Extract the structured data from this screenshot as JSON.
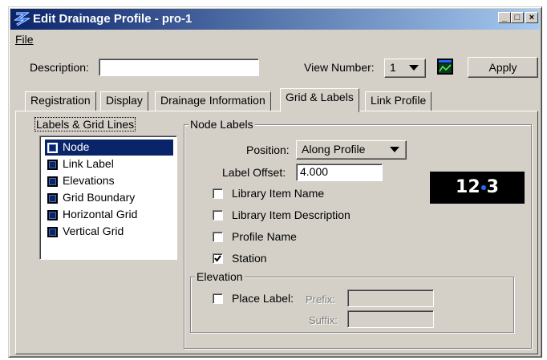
{
  "window": {
    "title": "Edit Drainage Profile - pro-1",
    "controls": {
      "minimize": "_",
      "maximize": "□",
      "close": "×"
    }
  },
  "menu": {
    "file": "File"
  },
  "toolbar": {
    "description_label": "Description:",
    "description_value": "",
    "view_number_label": "View Number:",
    "view_number_value": "1",
    "apply_label": "Apply"
  },
  "tabs": [
    {
      "label": "Registration"
    },
    {
      "label": "Display"
    },
    {
      "label": "Drainage Information"
    },
    {
      "label": "Grid & Labels",
      "active": true
    },
    {
      "label": "Link Profile"
    }
  ],
  "labels_grid": {
    "title": "Labels & Grid Lines",
    "items": [
      "Node",
      "Link Label",
      "Elevations",
      "Grid Boundary",
      "Horizontal Grid",
      "Vertical Grid"
    ],
    "selected": "Node"
  },
  "node_labels": {
    "title": "Node Labels",
    "position_label": "Position:",
    "position_value": "Along Profile",
    "label_offset_label": "Label Offset:",
    "label_offset_value": "4.000",
    "checkboxes": [
      {
        "label": "Library Item Name",
        "checked": false
      },
      {
        "label": "Library Item Description",
        "checked": false
      },
      {
        "label": "Profile Name",
        "checked": false
      },
      {
        "label": "Station",
        "checked": true
      }
    ],
    "preview_left": "12",
    "preview_right": "3"
  },
  "elevation": {
    "title": "Elevation",
    "place_label": "Place Label:",
    "place_label_checked": false,
    "prefix_label": "Prefix:",
    "prefix_value": "",
    "suffix_label": "Suffix:",
    "suffix_value": ""
  },
  "colors": {
    "titlebar_start": "#0a246a",
    "titlebar_end": "#a6caf0",
    "face": "#d4d0c8",
    "selection": "#0a246a"
  }
}
